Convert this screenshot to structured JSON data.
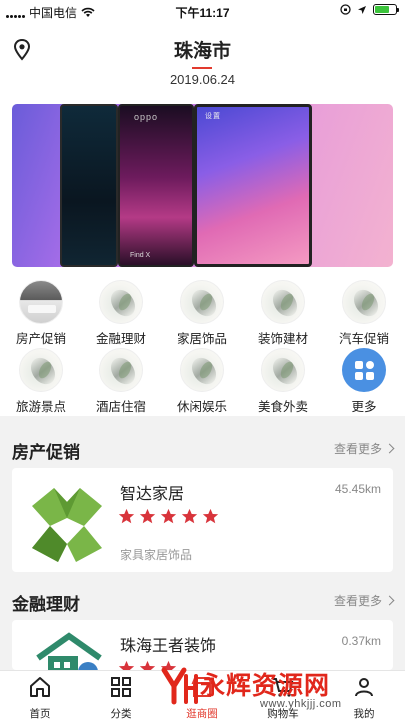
{
  "status_bar": {
    "carrier": "中国电信",
    "time": "下午11:17"
  },
  "header": {
    "city": "珠海市",
    "date": "2019.06.24"
  },
  "banner": {
    "phone_brand": "oppo",
    "phone_model": "Find X",
    "screen_label": "设置"
  },
  "categories": [
    {
      "label": "房产促销",
      "icon": "house-book-icon"
    },
    {
      "label": "金融理财",
      "icon": "ink-painting-icon"
    },
    {
      "label": "家居饰品",
      "icon": "ink-painting-icon"
    },
    {
      "label": "装饰建材",
      "icon": "ink-painting-icon"
    },
    {
      "label": "汽车促销",
      "icon": "ink-painting-icon"
    },
    {
      "label": "旅游景点",
      "icon": "ink-painting-icon"
    },
    {
      "label": "酒店住宿",
      "icon": "ink-painting-icon"
    },
    {
      "label": "休闲娱乐",
      "icon": "ink-painting-icon"
    },
    {
      "label": "美食外卖",
      "icon": "ink-painting-icon"
    },
    {
      "label": "更多",
      "icon": "grid-more-icon"
    }
  ],
  "sections": [
    {
      "title": "房产促销",
      "more": "查看更多",
      "card": {
        "name": "智达家居",
        "distance": "45.45km",
        "rating": 5,
        "tag": "家具家居饰品"
      }
    },
    {
      "title": "金融理财",
      "more": "查看更多",
      "card": {
        "name": "珠海王者装饰",
        "distance": "0.37km",
        "rating": 5
      }
    }
  ],
  "tabbar": [
    {
      "label": "首页",
      "icon": "home-icon"
    },
    {
      "label": "分类",
      "icon": "category-grid-icon"
    },
    {
      "label": "逛商圈",
      "icon": "shop-icon",
      "active": true
    },
    {
      "label": "购物车",
      "icon": "cart-icon"
    },
    {
      "label": "我的",
      "icon": "user-icon"
    }
  ],
  "watermark": {
    "text": "永辉资源网",
    "url": "www.yhkjjj.com"
  },
  "colors": {
    "accent": "#e23a2e",
    "star": "#d8343b",
    "more_button": "#4a90e2"
  }
}
